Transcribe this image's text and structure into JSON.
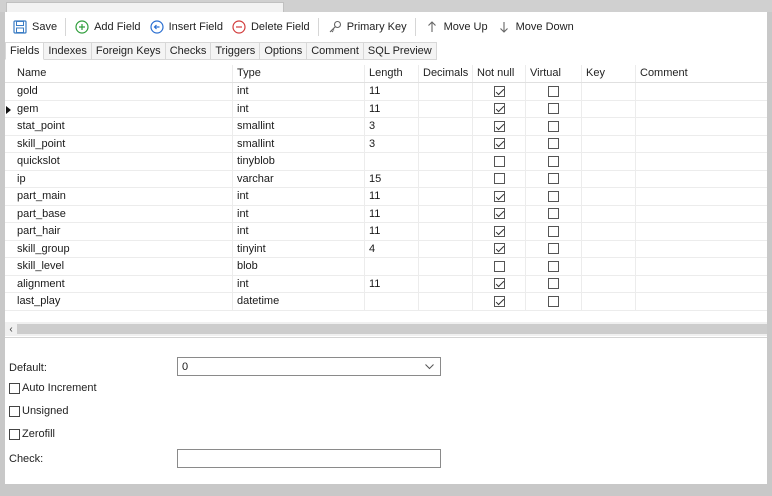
{
  "toolbar": {
    "save": "Save",
    "add_field": "Add Field",
    "insert_field": "Insert Field",
    "delete_field": "Delete Field",
    "primary_key": "Primary Key",
    "move_up": "Move Up",
    "move_down": "Move Down"
  },
  "tabs": [
    {
      "label": "Fields",
      "active": true
    },
    {
      "label": "Indexes"
    },
    {
      "label": "Foreign Keys"
    },
    {
      "label": "Checks"
    },
    {
      "label": "Triggers"
    },
    {
      "label": "Options"
    },
    {
      "label": "Comment"
    },
    {
      "label": "SQL Preview"
    }
  ],
  "columns": {
    "name": "Name",
    "type": "Type",
    "length": "Length",
    "decimals": "Decimals",
    "not_null": "Not null",
    "virtual": "Virtual",
    "key": "Key",
    "comment": "Comment"
  },
  "fields": [
    {
      "name": "gold",
      "type": "int",
      "length": "11",
      "decimals": "",
      "not_null": true,
      "virtual": false,
      "key": "",
      "comment": ""
    },
    {
      "name": "gem",
      "type": "int",
      "length": "11",
      "decimals": "",
      "not_null": true,
      "virtual": false,
      "key": "",
      "comment": "",
      "selected": true
    },
    {
      "name": "stat_point",
      "type": "smallint",
      "length": "3",
      "decimals": "",
      "not_null": true,
      "virtual": false,
      "key": "",
      "comment": ""
    },
    {
      "name": "skill_point",
      "type": "smallint",
      "length": "3",
      "decimals": "",
      "not_null": true,
      "virtual": false,
      "key": "",
      "comment": ""
    },
    {
      "name": "quickslot",
      "type": "tinyblob",
      "length": "",
      "decimals": "",
      "not_null": false,
      "virtual": false,
      "key": "",
      "comment": ""
    },
    {
      "name": "ip",
      "type": "varchar",
      "length": "15",
      "decimals": "",
      "not_null": false,
      "virtual": false,
      "key": "",
      "comment": ""
    },
    {
      "name": "part_main",
      "type": "int",
      "length": "11",
      "decimals": "",
      "not_null": true,
      "virtual": false,
      "key": "",
      "comment": ""
    },
    {
      "name": "part_base",
      "type": "int",
      "length": "11",
      "decimals": "",
      "not_null": true,
      "virtual": false,
      "key": "",
      "comment": ""
    },
    {
      "name": "part_hair",
      "type": "int",
      "length": "11",
      "decimals": "",
      "not_null": true,
      "virtual": false,
      "key": "",
      "comment": ""
    },
    {
      "name": "skill_group",
      "type": "tinyint",
      "length": "4",
      "decimals": "",
      "not_null": true,
      "virtual": false,
      "key": "",
      "comment": ""
    },
    {
      "name": "skill_level",
      "type": "blob",
      "length": "",
      "decimals": "",
      "not_null": false,
      "virtual": false,
      "key": "",
      "comment": ""
    },
    {
      "name": "alignment",
      "type": "int",
      "length": "11",
      "decimals": "",
      "not_null": true,
      "virtual": false,
      "key": "",
      "comment": ""
    },
    {
      "name": "last_play",
      "type": "datetime",
      "length": "",
      "decimals": "",
      "not_null": true,
      "virtual": false,
      "key": "",
      "comment": ""
    }
  ],
  "props": {
    "default_label": "Default:",
    "default_value": "0",
    "auto_increment": "Auto Increment",
    "unsigned": "Unsigned",
    "zerofill": "Zerofill",
    "check_label": "Check:",
    "check_value": ""
  },
  "colors": {
    "add_icon": "#2e9d3a",
    "insert_icon": "#2b6fd1",
    "delete_icon": "#d23c3c",
    "save_icon": "#3a7cc4"
  }
}
